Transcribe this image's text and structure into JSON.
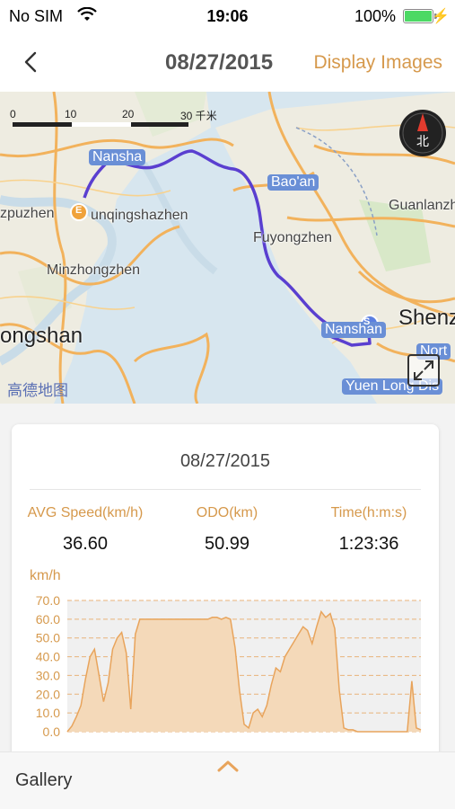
{
  "status": {
    "carrier": "No SIM",
    "time": "19:06",
    "battery": "100%"
  },
  "nav": {
    "title": "08/27/2015",
    "action": "Display Images"
  },
  "map": {
    "scale_labels": [
      "0",
      "10",
      "20",
      "30 千米"
    ],
    "places": [
      "Nansha",
      "Bao'an",
      "Guanlanzh",
      "zpuzhen",
      "unqingshazhen",
      "Fuyongzhen",
      "Minzhongzhen",
      "ongshan",
      "Nanshan",
      "Shenz",
      "Nort",
      "Yuen Long Dis"
    ],
    "logo": "高德地图",
    "compass_label": "北",
    "start_marker": "S",
    "end_marker": "E"
  },
  "trip": {
    "date": "08/27/2015",
    "stats": [
      {
        "label": "AVG Speed(km/h)",
        "value": "36.60"
      },
      {
        "label": "ODO(km)",
        "value": "50.99"
      },
      {
        "label": "Time(h:m:s)",
        "value": "1:23:36"
      }
    ]
  },
  "chart_data": {
    "type": "area",
    "ylabel": "km/h",
    "ylim": [
      0,
      70
    ],
    "yticks": [
      "70.0",
      "60.0",
      "50.0",
      "40.0",
      "30.0",
      "20.0",
      "10.0",
      "0.0"
    ],
    "grid": true,
    "color": "#e8a45c",
    "y": [
      0,
      3,
      8,
      14,
      28,
      40,
      44,
      30,
      16,
      26,
      44,
      50,
      53,
      42,
      12,
      52,
      60,
      60,
      60,
      60,
      60,
      60,
      60,
      60,
      60,
      60,
      60,
      60,
      60,
      60,
      60,
      60,
      61,
      61,
      60,
      61,
      60,
      45,
      22,
      4,
      2,
      10,
      12,
      8,
      14,
      25,
      34,
      32,
      40,
      44,
      48,
      52,
      56,
      54,
      47,
      56,
      64,
      61,
      63,
      55,
      22,
      2,
      1,
      1,
      0,
      0,
      0,
      0,
      0,
      0,
      0,
      0,
      0,
      0,
      0,
      0,
      27,
      2,
      1
    ]
  },
  "bottom": {
    "gallery": "Gallery"
  },
  "colors": {
    "accent": "#d6994c",
    "route": "#5a3fd0",
    "area_fill": "#f4d9b9"
  }
}
